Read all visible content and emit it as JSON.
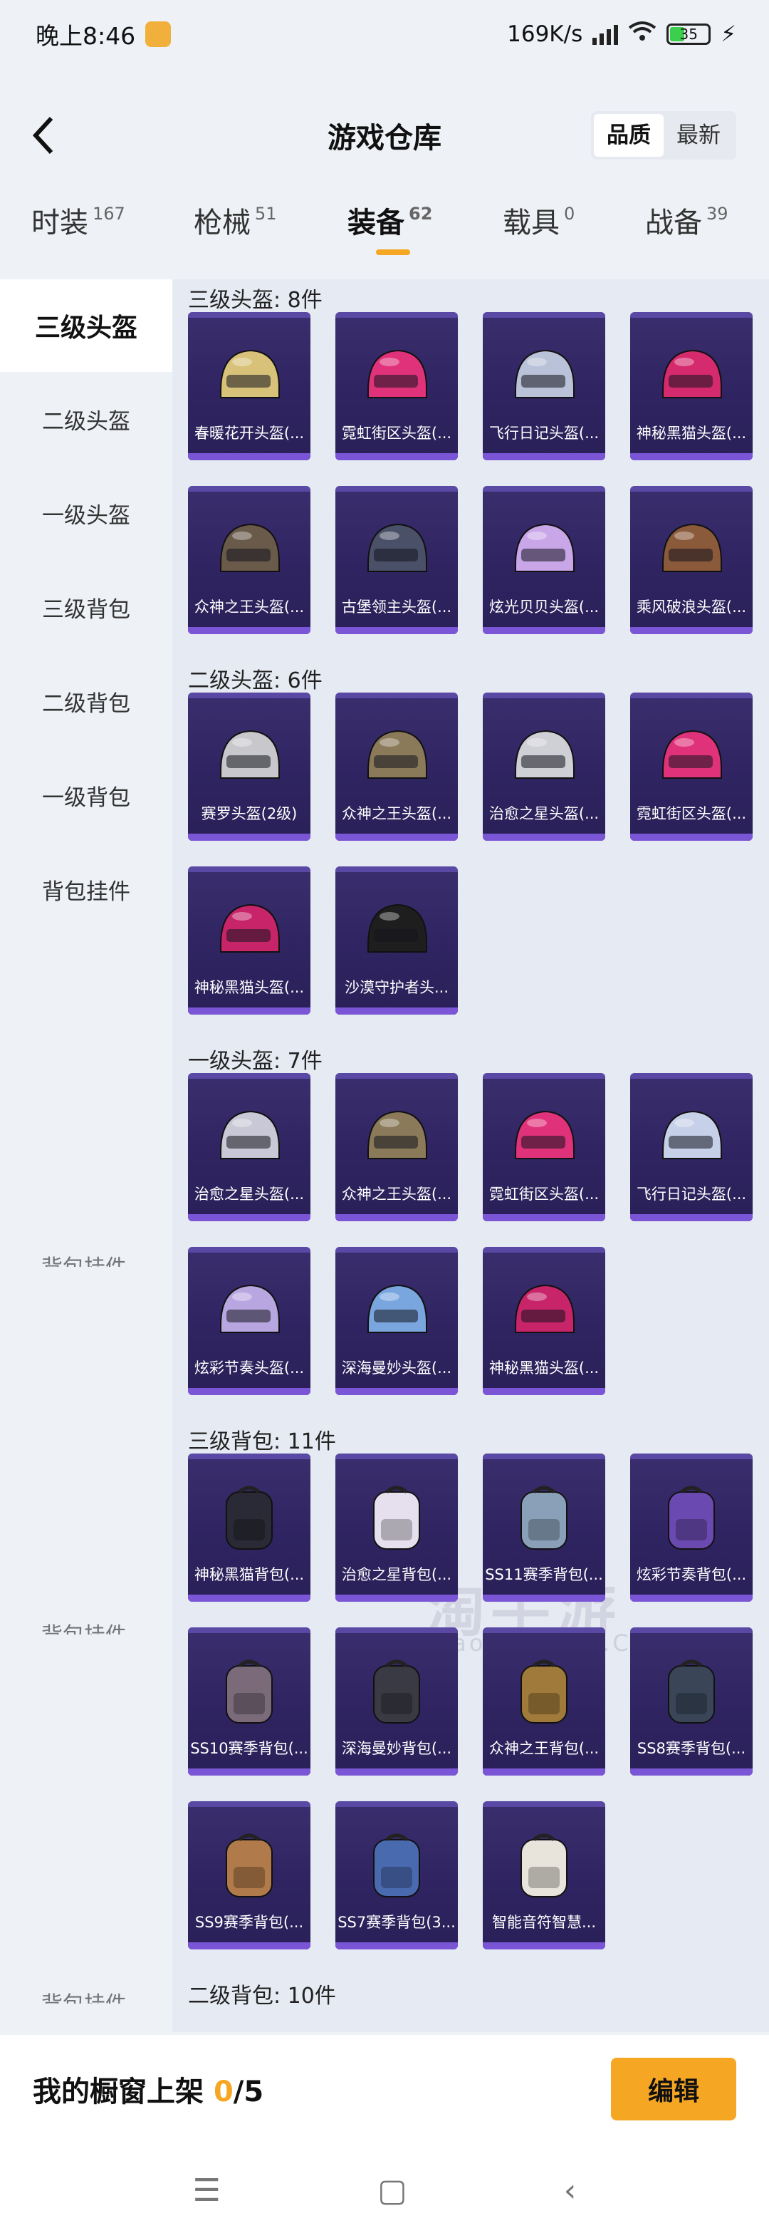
{
  "status_bar": {
    "time": "晚上8:46",
    "speed": "169K/s",
    "battery": "35"
  },
  "header": {
    "title": "游戏仓库",
    "sort_options": [
      "品质",
      "最新"
    ]
  },
  "tabs": [
    {
      "label": "时装",
      "count": "167"
    },
    {
      "label": "枪械",
      "count": "51"
    },
    {
      "label": "装备",
      "count": "62"
    },
    {
      "label": "载具",
      "count": "0"
    },
    {
      "label": "战备",
      "count": "39"
    }
  ],
  "sidebar": [
    "三级头盔",
    "二级头盔",
    "一级头盔",
    "三级背包",
    "二级背包",
    "一级背包",
    "背包挂件"
  ],
  "sections": [
    {
      "title": "三级头盔: 8件",
      "items": [
        "春暖花开头盔(...",
        "霓虹街区头盔(...",
        "飞行日记头盔(...",
        "神秘黑猫头盔(...",
        "众神之王头盔(...",
        "古堡领主头盔(...",
        "炫光贝贝头盔(...",
        "乘风破浪头盔(..."
      ]
    },
    {
      "title": "二级头盔: 6件",
      "items": [
        "赛罗头盔(2级)",
        "众神之王头盔(...",
        "治愈之星头盔(...",
        "霓虹街区头盔(...",
        "神秘黑猫头盔(...",
        "沙漠守护者头..."
      ]
    },
    {
      "title": "一级头盔: 7件",
      "items": [
        "治愈之星头盔(...",
        "众神之王头盔(...",
        "霓虹街区头盔(...",
        "飞行日记头盔(...",
        "炫彩节奏头盔(...",
        "深海曼妙头盔(...",
        "神秘黑猫头盔(..."
      ]
    },
    {
      "title": "三级背包: 11件",
      "items": [
        "神秘黑猫背包(...",
        "治愈之星背包(...",
        "SS11赛季背包(...",
        "炫彩节奏背包(...",
        "SS10赛季背包(...",
        "深海曼妙背包(...",
        "众神之王背包(...",
        "SS8赛季背包(...",
        "SS9赛季背包(...",
        "SS7赛季背包(3...",
        "智能音符智慧..."
      ]
    },
    {
      "title": "二级背包: 10件",
      "items": []
    }
  ],
  "ghost_labels": [
    "背包挂件",
    "背包挂件",
    "背包挂件"
  ],
  "watermark": {
    "main": "淘手游",
    "sub": "Taoshouyou.Com"
  },
  "footer": {
    "label": "我的橱窗上架 ",
    "count": "0",
    "total": "/5",
    "edit": "编辑"
  },
  "nav": {
    "menu": "☰",
    "home": "▢",
    "back": "‹"
  },
  "colors": {
    "accent": "#f5a623",
    "card_bg": "#2f2461",
    "card_strip": "#7a55d6"
  }
}
